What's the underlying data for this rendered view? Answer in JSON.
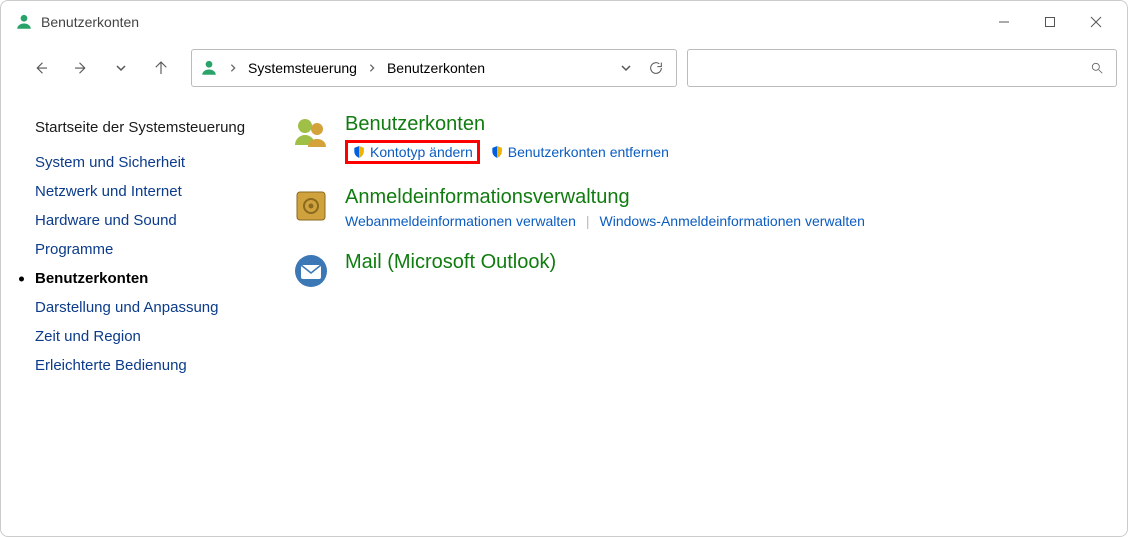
{
  "window": {
    "title": "Benutzerkonten"
  },
  "breadcrumb": {
    "items": [
      "Systemsteuerung",
      "Benutzerkonten"
    ]
  },
  "search": {
    "placeholder": ""
  },
  "sidebar": {
    "home": "Startseite der Systemsteuerung",
    "items": [
      {
        "label": "System und Sicherheit",
        "active": false
      },
      {
        "label": "Netzwerk und Internet",
        "active": false
      },
      {
        "label": "Hardware und Sound",
        "active": false
      },
      {
        "label": "Programme",
        "active": false
      },
      {
        "label": "Benutzerkonten",
        "active": true
      },
      {
        "label": "Darstellung und Anpassung",
        "active": false
      },
      {
        "label": "Zeit und Region",
        "active": false
      },
      {
        "label": "Erleichterte Bedienung",
        "active": false
      }
    ]
  },
  "categories": [
    {
      "heading": "Benutzerkonten",
      "links": [
        {
          "label": "Kontotyp ändern",
          "shield": true,
          "highlighted": true
        },
        {
          "label": "Benutzerkonten entfernen",
          "shield": true,
          "highlighted": false
        }
      ]
    },
    {
      "heading": "Anmeldeinformationsverwaltung",
      "links": [
        {
          "label": "Webanmeldeinformationen verwalten",
          "shield": false,
          "highlighted": false
        },
        {
          "label": "Windows-Anmeldeinformationen verwalten",
          "shield": false,
          "highlighted": false
        }
      ]
    },
    {
      "heading": "Mail (Microsoft Outlook)",
      "links": []
    }
  ]
}
